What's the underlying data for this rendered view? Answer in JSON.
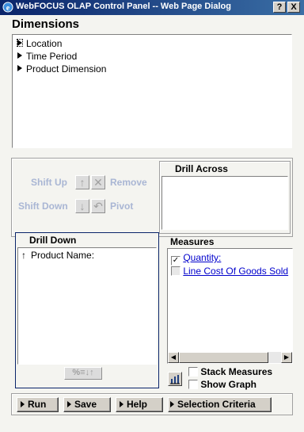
{
  "window": {
    "title": "WebFOCUS OLAP Control Panel -- Web Page Dialog",
    "help_label": "?",
    "close_label": "X"
  },
  "dimensions": {
    "title": "Dimensions",
    "items": [
      {
        "label": "Location"
      },
      {
        "label": "Time Period"
      },
      {
        "label": "Product Dimension"
      }
    ]
  },
  "controls": {
    "shift_up": "Shift Up",
    "remove": "Remove",
    "shift_down": "Shift Down",
    "pivot": "Pivot"
  },
  "drill_across": {
    "title": "Drill Across"
  },
  "drill_down": {
    "title": "Drill Down",
    "items": [
      {
        "label": "Product Name:"
      }
    ],
    "sort_button_label": "%≡↓↑"
  },
  "measures": {
    "title": "Measures",
    "items": [
      {
        "label": "Quantity:",
        "checked": true
      },
      {
        "label": "Line Cost Of Goods Sold",
        "checked": false
      }
    ]
  },
  "options": {
    "stack_measures": "Stack Measures",
    "show_graph": "Show Graph"
  },
  "buttons": {
    "run": "Run",
    "save": "Save",
    "help": "Help",
    "selection_criteria": "Selection Criteria"
  },
  "colors": {
    "title_bar_start": "#0a246a",
    "title_bar_end": "#3a6ea5",
    "disabled_text": "#a9b6d4",
    "link": "#0000cc",
    "drill_down_border": "#0a246a"
  }
}
